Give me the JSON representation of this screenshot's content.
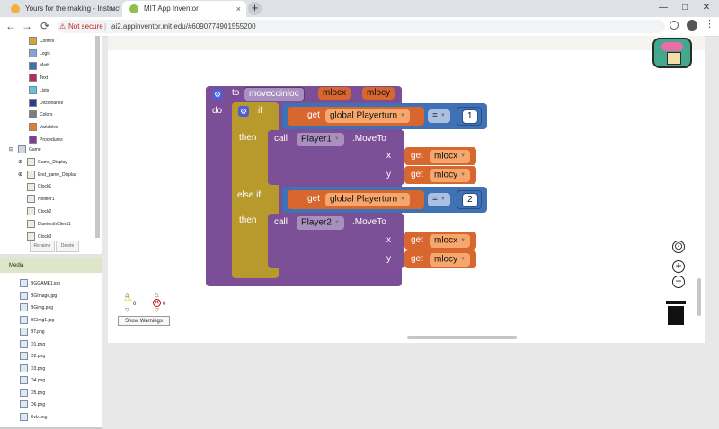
{
  "browser": {
    "tabs": [
      {
        "title": "Yours for the making - Instructab",
        "close": "×"
      },
      {
        "title": "MIT App Inventor",
        "close": "×"
      }
    ],
    "new_tab": "+",
    "window": {
      "minimize": "—",
      "maximize": "□",
      "close": "✕"
    },
    "nav": {
      "back": "←",
      "forward": "→",
      "reload": "⟳"
    },
    "address": {
      "security": "Not secure",
      "separator": "|",
      "url": "ai2.appinventor.mit.edu/#6090774901555200"
    }
  },
  "blocks_tree": {
    "builtin": [
      {
        "label": "Control",
        "color": "#d2a43a"
      },
      {
        "label": "Logic",
        "color": "#7ba8d8"
      },
      {
        "label": "Math",
        "color": "#3f71b5"
      },
      {
        "label": "Text",
        "color": "#b32d5e"
      },
      {
        "label": "Lists",
        "color": "#5bc4e8"
      },
      {
        "label": "Dictionaries",
        "color": "#2d3b8c"
      },
      {
        "label": "Colors",
        "color": "#7d7d7d"
      },
      {
        "label": "Variables",
        "color": "#e97c2b"
      },
      {
        "label": "Procedures",
        "color": "#7a3f96"
      }
    ],
    "components": [
      {
        "label": "Game",
        "depth": 0,
        "expand": "⊟"
      },
      {
        "label": "Game_Display",
        "depth": 1,
        "expand": "⊕"
      },
      {
        "label": "End_game_Display",
        "depth": 1,
        "expand": "⊕"
      },
      {
        "label": "Clock1",
        "depth": 1,
        "expand": ""
      },
      {
        "label": "Notifier1",
        "depth": 1,
        "expand": ""
      },
      {
        "label": "Clock2",
        "depth": 1,
        "expand": ""
      },
      {
        "label": "BluetoothClient1",
        "depth": 1,
        "expand": ""
      },
      {
        "label": "Clock3",
        "depth": 1,
        "expand": ""
      }
    ],
    "rename_button": "Rename",
    "delete_button": "Delete"
  },
  "media": {
    "header": "Media",
    "files": [
      "BGGAME1.jpg",
      "BGImage.jpg",
      "BGimg.png",
      "BGimg1.jpg",
      "BT.png",
      "D1.png",
      "D2.png",
      "D3.png",
      "D4.png",
      "D5.png",
      "D6.png",
      "Evb.png"
    ]
  },
  "procedure": {
    "keyword_to": "to",
    "name": "movecoinloc",
    "params": [
      "mlocx",
      "mlocy"
    ],
    "keyword_do": "do",
    "if_label": "if",
    "then_label": "then",
    "elseif_label": "else if",
    "get_label": "get",
    "global_var": "global Playerturn",
    "op": "=",
    "value1": "1",
    "value2": "2",
    "call_label": "call",
    "method": ".MoveTo",
    "components": [
      "Player1",
      "Player2"
    ],
    "arg_x": "x",
    "arg_y": "y",
    "arg_x_var": "mlocx",
    "arg_y_var": "mlocy"
  },
  "warnings": {
    "warning_count": "0",
    "error_count": "0",
    "show_warnings": "Show Warnings"
  },
  "workspace_controls": {
    "center": "⊙",
    "zoom_in": "+",
    "zoom_out": "−"
  },
  "colors": {
    "procedure": "#7b4e97",
    "control": "#b89a2c",
    "variable": "#d8662f",
    "component": "#7c5096",
    "math": "#3f71b5"
  }
}
